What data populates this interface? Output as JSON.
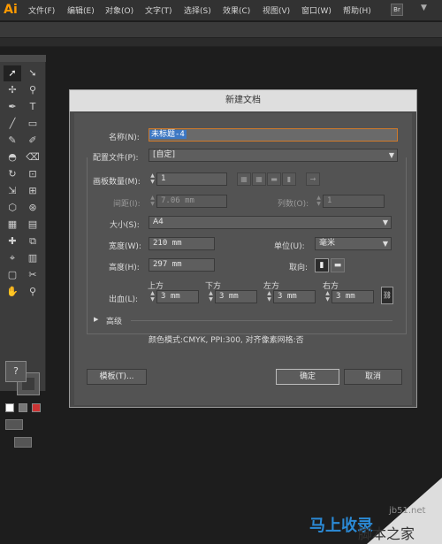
{
  "app": {
    "logo": "Ai",
    "br_button": "Br",
    "workspace_arrow": "▼"
  },
  "menu": [
    "文件(F)",
    "编辑(E)",
    "对象(O)",
    "文字(T)",
    "选择(S)",
    "效果(C)",
    "视图(V)",
    "窗口(W)",
    "帮助(H)"
  ],
  "tools": [
    [
      "➚",
      "➘"
    ],
    [
      "✢",
      "⚲"
    ],
    [
      "✒",
      "T"
    ],
    [
      "╱",
      "▭"
    ],
    [
      "✎",
      "✐"
    ],
    [
      "◓",
      "⌫"
    ],
    [
      "↻",
      "⊡"
    ],
    [
      "⇲",
      "⊞"
    ],
    [
      "⬡",
      "⊛"
    ],
    [
      "▦",
      "▤"
    ],
    [
      "✚",
      "⧉"
    ],
    [
      "⌖",
      "▥"
    ],
    [
      "▢",
      "✂"
    ],
    [
      "✋",
      "⚲"
    ]
  ],
  "fill_stroke": {
    "fill_symbol": "?"
  },
  "dialog": {
    "title": "新建文档",
    "name_label": "名称(N):",
    "name_value": "未标题-4",
    "profile_label": "配置文件(P):",
    "profile_value": "[自定]",
    "artboards_label": "画板数量(M):",
    "artboards_value": "1",
    "spacing_label": "间距(I):",
    "spacing_value": "7.06 mm",
    "columns_label": "列数(O):",
    "columns_value": "1",
    "size_label": "大小(S):",
    "size_value": "A4",
    "width_label": "宽度(W):",
    "width_value": "210 mm",
    "units_label": "单位(U):",
    "units_value": "毫米",
    "height_label": "高度(H):",
    "height_value": "297 mm",
    "orientation_label": "取向:",
    "bleed_label": "出血(L):",
    "bleed_top_label": "上方",
    "bleed_bottom_label": "下方",
    "bleed_left_label": "左方",
    "bleed_right_label": "右方",
    "bleed_top": "3 mm",
    "bleed_bottom": "3 mm",
    "bleed_left": "3 mm",
    "bleed_right": "3 mm",
    "advanced_label": "高级",
    "info_text": "颜色模式:CMYK, PPI:300, 对齐像素网格:否",
    "templates_button": "模板(T)...",
    "ok_button": "确定",
    "cancel_button": "取消"
  },
  "watermark": {
    "brand_a": "马上收录",
    "brand_b": "脚本之家",
    "site": "jb51.net"
  }
}
